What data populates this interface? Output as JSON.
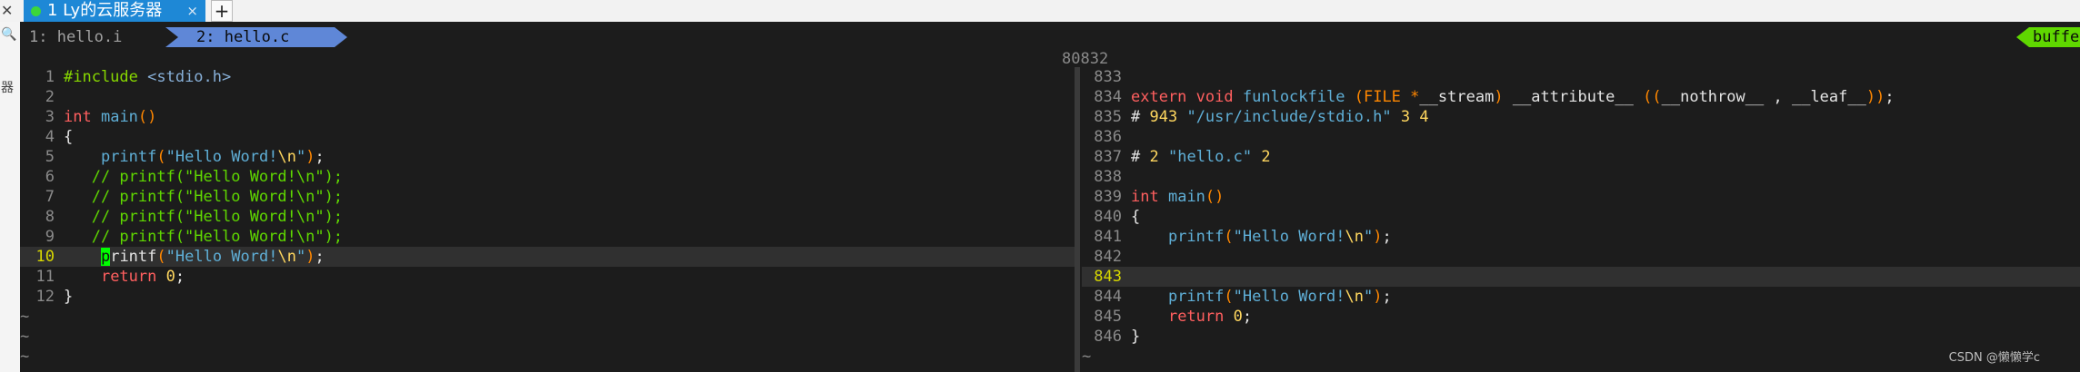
{
  "window": {
    "tab_title": "1 Ly的云服务器",
    "tab_close": "×",
    "new_tab": "+",
    "left_strip_glyphs": [
      "✕",
      "🔍",
      "器"
    ]
  },
  "vim": {
    "tabs": [
      {
        "label": "1: hello.i",
        "active": false
      },
      {
        "label": "2: hello.c",
        "active": true
      }
    ],
    "buffer_tag": "buffe",
    "left_pane": {
      "file": "hello.c",
      "lines": [
        {
          "n": "1",
          "text": "#include <stdio.h>"
        },
        {
          "n": "2",
          "text": ""
        },
        {
          "n": "3",
          "text": "int main()"
        },
        {
          "n": "4",
          "text": "{"
        },
        {
          "n": "5",
          "text": "    printf(\"Hello Word!\\n\");"
        },
        {
          "n": "6",
          "text": "   // printf(\"Hello Word!\\n\");"
        },
        {
          "n": "7",
          "text": "   // printf(\"Hello Word!\\n\");"
        },
        {
          "n": "8",
          "text": "   // printf(\"Hello Word!\\n\");"
        },
        {
          "n": "9",
          "text": "   // printf(\"Hello Word!\\n\");"
        },
        {
          "n": "10",
          "text": "    printf(\"Hello Word!\\n\");",
          "cursor": true
        },
        {
          "n": "11",
          "text": "    return 0;"
        },
        {
          "n": "12",
          "text": "}"
        }
      ],
      "tildes": 4
    },
    "right_pane": {
      "file": "hello.i",
      "scroll_indicator": "80832",
      "lines": [
        {
          "n": "833",
          "text": ""
        },
        {
          "n": "834",
          "text": "extern void funlockfile (FILE *__stream) __attribute__ ((__nothrow__ , __leaf__));"
        },
        {
          "n": "835",
          "text": "# 943 \"/usr/include/stdio.h\" 3 4"
        },
        {
          "n": "836",
          "text": ""
        },
        {
          "n": "837",
          "text": "# 2 \"hello.c\" 2"
        },
        {
          "n": "838",
          "text": ""
        },
        {
          "n": "839",
          "text": "int main()"
        },
        {
          "n": "840",
          "text": "{"
        },
        {
          "n": "841",
          "text": "    printf(\"Hello Word!\\n\");"
        },
        {
          "n": "842",
          "text": ""
        },
        {
          "n": "843",
          "text": "",
          "cursor": true
        },
        {
          "n": "844",
          "text": "    printf(\"Hello Word!\\n\");"
        },
        {
          "n": "845",
          "text": "    return 0;"
        },
        {
          "n": "846",
          "text": "}"
        }
      ],
      "tildes": 1
    }
  },
  "watermark": "CSDN @懒懒学c"
}
